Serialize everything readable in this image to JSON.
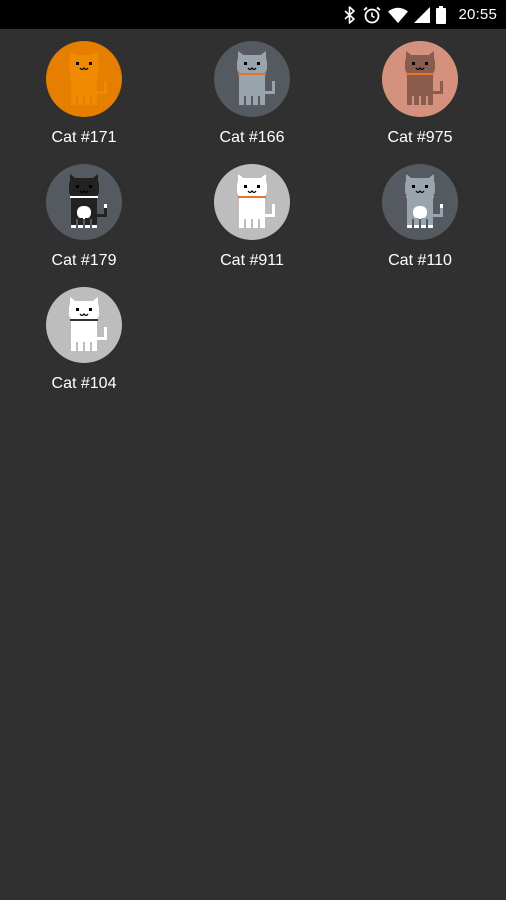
{
  "status_bar": {
    "time": "20:55",
    "icons": [
      "bluetooth-icon",
      "alarm-icon",
      "wifi-icon",
      "cellular-signal-icon",
      "battery-icon"
    ]
  },
  "cats": [
    {
      "name": "Cat #171",
      "bg": "#e67e00",
      "body": "#f08a00",
      "accent": "#f08a00",
      "collar": "#f08a00"
    },
    {
      "name": "Cat #166",
      "bg": "#555a60",
      "body": "#9aa4ac",
      "accent": "#9aa4ac",
      "collar": "#e8742a"
    },
    {
      "name": "Cat #975",
      "bg": "#d4927e",
      "body": "#8a5c4e",
      "accent": "#8a5c4e",
      "collar": "#e8742a"
    },
    {
      "name": "Cat #179",
      "bg": "#555a60",
      "body": "#222222",
      "accent": "#ffffff",
      "collar": "#ffffff"
    },
    {
      "name": "Cat #911",
      "bg": "#bdbdbd",
      "body": "#ffffff",
      "accent": "#ffffff",
      "collar": "#e8742a"
    },
    {
      "name": "Cat #110",
      "bg": "#555a60",
      "body": "#9aa4ac",
      "accent": "#ffffff",
      "collar": "#9aa4ac"
    },
    {
      "name": "Cat #104",
      "bg": "#bdbdbd",
      "body": "#ffffff",
      "accent": "#ffffff",
      "collar": "#333333"
    }
  ]
}
